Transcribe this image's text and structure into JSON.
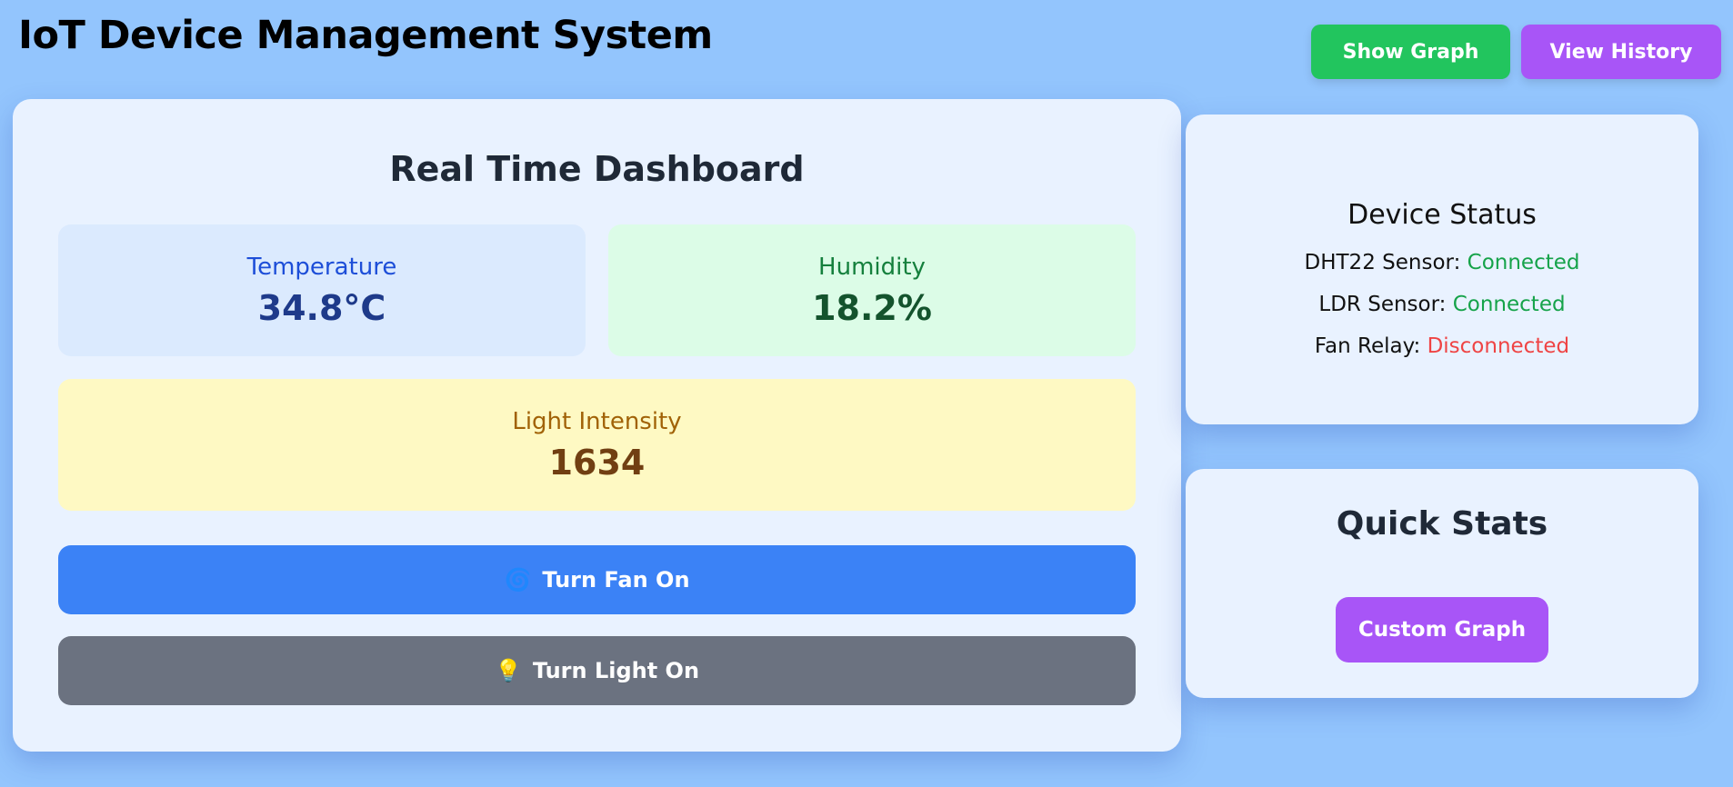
{
  "app": {
    "title": "IoT Device Management System"
  },
  "header": {
    "show_graph_label": "Show Graph",
    "view_history_label": "View History"
  },
  "dashboard": {
    "title": "Real Time Dashboard",
    "temperature": {
      "label": "Temperature",
      "value": "34.8°C"
    },
    "humidity": {
      "label": "Humidity",
      "value": "18.2%"
    },
    "light": {
      "label": "Light Intensity",
      "value": "1634"
    },
    "fan_button": {
      "icon": "🌀",
      "label": "Turn Fan On"
    },
    "light_button": {
      "icon": "💡",
      "label": "Turn Light On"
    }
  },
  "device_status": {
    "title": "Device Status",
    "items": [
      {
        "label": "DHT22 Sensor:",
        "status": "Connected",
        "color": "#16a34a"
      },
      {
        "label": "LDR Sensor:",
        "status": "Connected",
        "color": "#16a34a"
      },
      {
        "label": "Fan Relay:",
        "status": "Disconnected",
        "color": "#ef4444"
      }
    ]
  },
  "quick_stats": {
    "title": "Quick Stats",
    "custom_graph_label": "Custom Graph"
  },
  "colors": {
    "background": "#93c5fd",
    "show_graph": "#22c55e",
    "view_history": "#a855f7",
    "fan_button": "#3b82f6",
    "light_button": "#6b7280",
    "custom_graph": "#a855f7"
  }
}
